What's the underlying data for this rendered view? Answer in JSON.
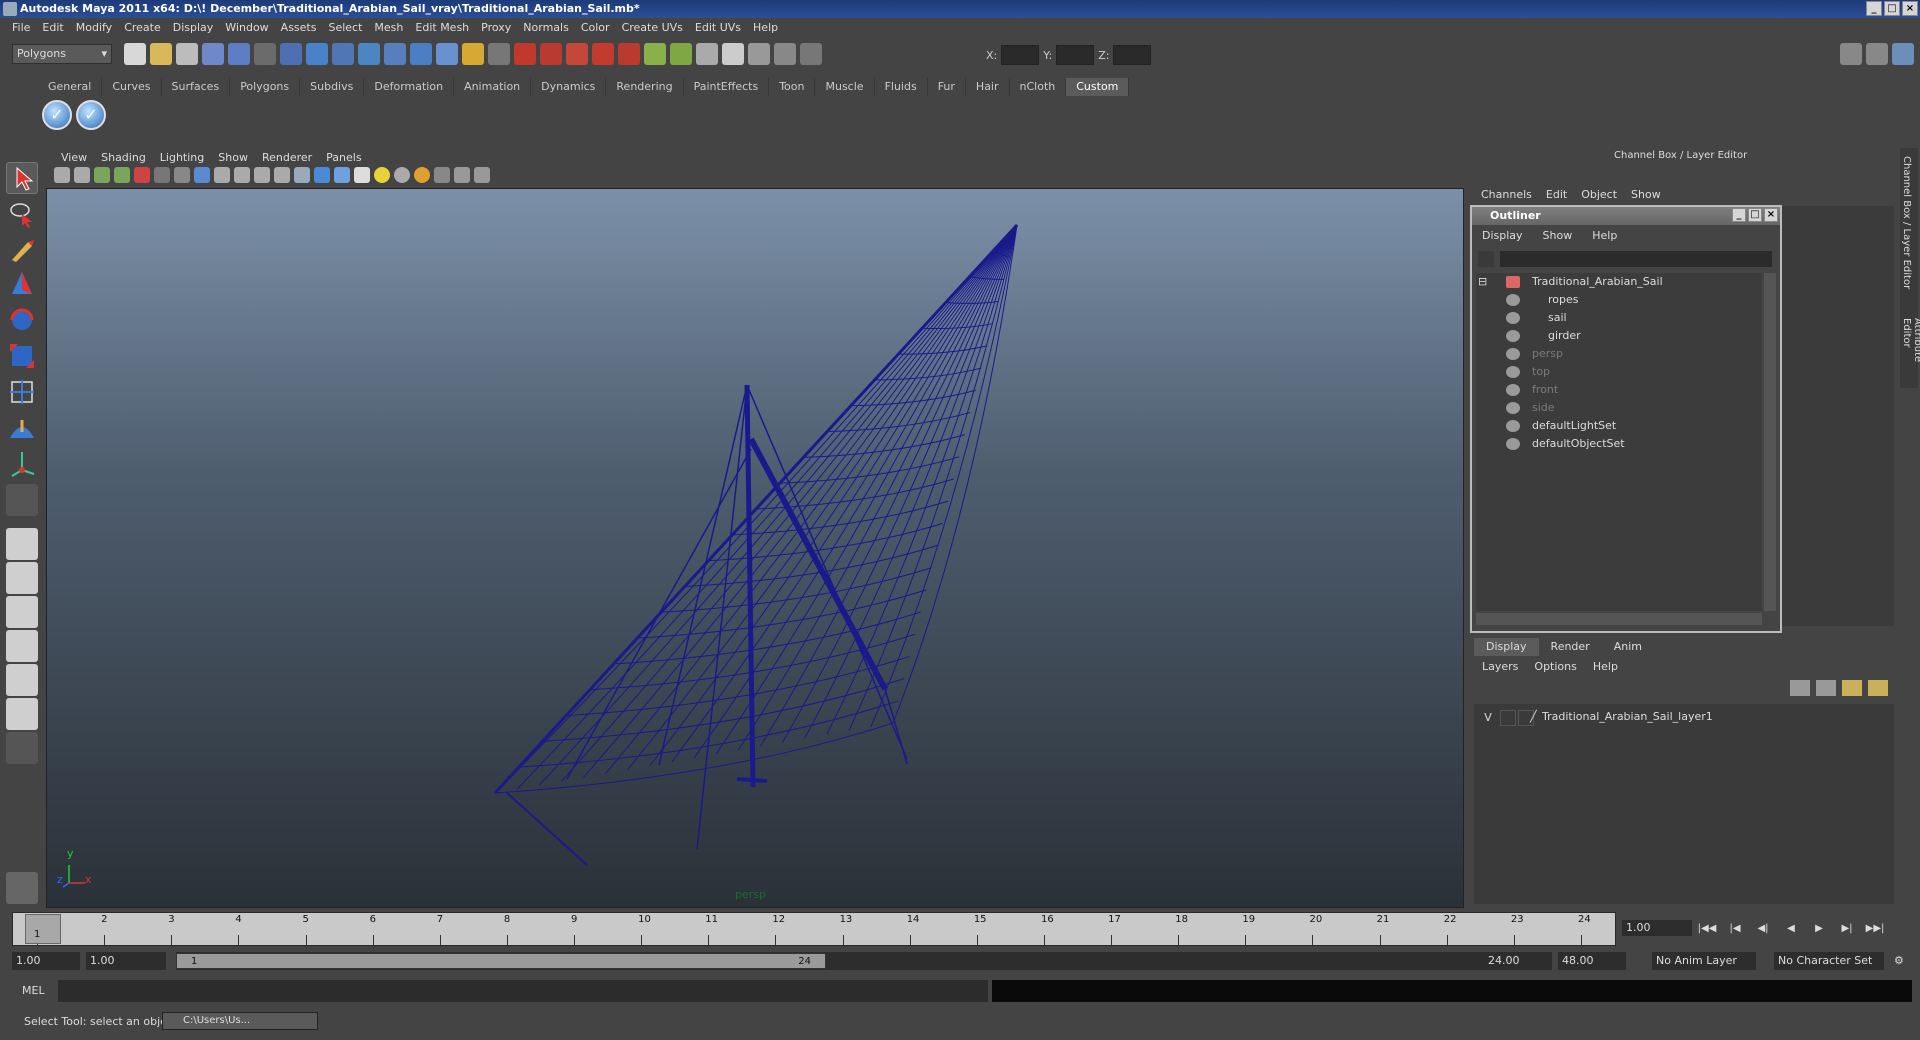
{
  "window": {
    "title": "Autodesk Maya 2011 x64: D:\\! December\\Traditional_Arabian_Sail_vray\\Traditional_Arabian_Sail.mb*"
  },
  "menubar": [
    "File",
    "Edit",
    "Modify",
    "Create",
    "Display",
    "Window",
    "Assets",
    "Select",
    "Mesh",
    "Edit Mesh",
    "Proxy",
    "Normals",
    "Color",
    "Create UVs",
    "Edit UVs",
    "Help"
  ],
  "status_line": {
    "mode": "Polygons",
    "x_label": "X:",
    "y_label": "Y:",
    "z_label": "Z:"
  },
  "shelf_tabs": [
    "General",
    "Curves",
    "Surfaces",
    "Polygons",
    "Subdivs",
    "Deformation",
    "Animation",
    "Dynamics",
    "Rendering",
    "PaintEffects",
    "Toon",
    "Muscle",
    "Fluids",
    "Fur",
    "Hair",
    "nCloth",
    "Custom"
  ],
  "shelf_active": "Custom",
  "viewport": {
    "menu": [
      "View",
      "Shading",
      "Lighting",
      "Show",
      "Renderer",
      "Panels"
    ],
    "camera_label": "persp",
    "axis": {
      "y": "y",
      "x": "x",
      "z": "z"
    }
  },
  "channel_box": {
    "title": "Channel Box / Layer Editor",
    "menu": [
      "Channels",
      "Edit",
      "Object",
      "Show"
    ],
    "side_tabs": [
      "Channel Box / Layer Editor",
      "Attribute Editor"
    ]
  },
  "outliner": {
    "title": "Outliner",
    "menu": [
      "Display",
      "Show",
      "Help"
    ],
    "items": [
      {
        "label": "Traditional_Arabian_Sail",
        "dim": false
      },
      {
        "label": "ropes",
        "dim": false
      },
      {
        "label": "sail",
        "dim": false
      },
      {
        "label": "girder",
        "dim": false
      },
      {
        "label": "persp",
        "dim": true
      },
      {
        "label": "top",
        "dim": true
      },
      {
        "label": "front",
        "dim": true
      },
      {
        "label": "side",
        "dim": true
      },
      {
        "label": "defaultLightSet",
        "dim": false
      },
      {
        "label": "defaultObjectSet",
        "dim": false
      }
    ]
  },
  "layer_editor": {
    "tabs": [
      "Display",
      "Render",
      "Anim"
    ],
    "active_tab": "Display",
    "menu": [
      "Layers",
      "Options",
      "Help"
    ],
    "layers": [
      {
        "visible": "V",
        "name": "Traditional_Arabian_Sail_layer1"
      }
    ]
  },
  "time_slider": {
    "ticks": [
      "1",
      "2",
      "3",
      "4",
      "5",
      "6",
      "7",
      "8",
      "9",
      "10",
      "11",
      "12",
      "13",
      "14",
      "15",
      "16",
      "17",
      "18",
      "19",
      "20",
      "21",
      "22",
      "23",
      "24"
    ],
    "current_frame_marker": "1",
    "current_time": "1.00"
  },
  "range_slider": {
    "anim_start": "1.00",
    "playback_start": "1.00",
    "thumb_start": "1",
    "thumb_end": "24",
    "playback_end": "24.00",
    "anim_end": "48.00",
    "anim_layer": "No Anim Layer",
    "character_set": "No Character Set"
  },
  "command_line": {
    "label": "MEL"
  },
  "help_line": {
    "text": "Select Tool: select an object",
    "task_button": "C:\\Users\\Us..."
  },
  "colors": {
    "wireframe": "#1a1a8c",
    "title_bar": "#1e3a78",
    "viewport_top": "#7b90a8",
    "viewport_bottom": "#2a3138"
  }
}
